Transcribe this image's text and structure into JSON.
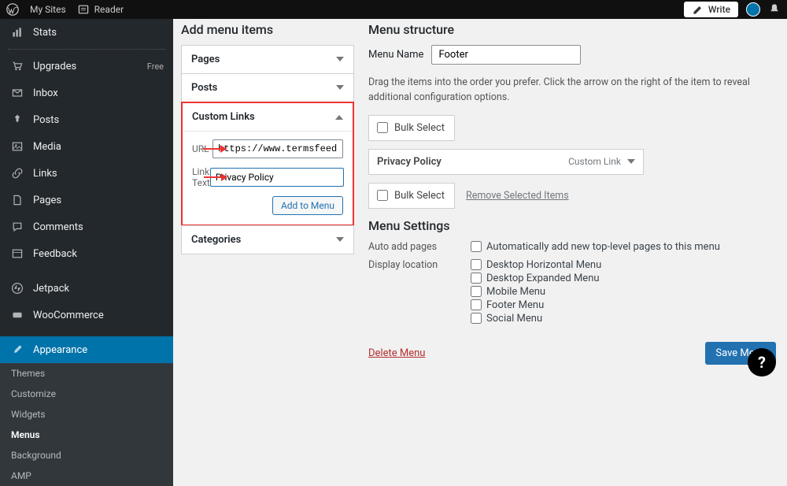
{
  "adminbar": {
    "my_sites": "My Sites",
    "reader": "Reader",
    "write": "Write"
  },
  "sidebar": {
    "items": [
      {
        "icon": "stats",
        "label": "Stats"
      },
      {
        "icon": "cart",
        "label": "Upgrades",
        "badge": "Free"
      },
      {
        "icon": "mail",
        "label": "Inbox"
      },
      {
        "icon": "pin",
        "label": "Posts"
      },
      {
        "icon": "media",
        "label": "Media"
      },
      {
        "icon": "link",
        "label": "Links"
      },
      {
        "icon": "page",
        "label": "Pages"
      },
      {
        "icon": "comment",
        "label": "Comments"
      },
      {
        "icon": "feedback",
        "label": "Feedback"
      },
      {
        "icon": "jetpack",
        "label": "Jetpack"
      },
      {
        "icon": "woo",
        "label": "WooCommerce"
      },
      {
        "icon": "brush",
        "label": "Appearance"
      }
    ],
    "submenu": [
      "Themes",
      "Customize",
      "Widgets",
      "Menus",
      "Background",
      "AMP"
    ]
  },
  "addmenu": {
    "heading": "Add menu items",
    "panels": {
      "pages": "Pages",
      "posts": "Posts",
      "custom": "Custom Links",
      "categories": "Categories"
    },
    "url_label": "URL",
    "url_value": "https://www.termsfeed",
    "linktext_label": "Link Text",
    "linktext_value": "Privacy Policy",
    "add_btn": "Add to Menu"
  },
  "structure": {
    "heading": "Menu structure",
    "name_label": "Menu Name",
    "name_value": "Footer",
    "drag_desc": "Drag the items into the order you prefer. Click the arrow on the right of the item to reveal additional configuration options.",
    "bulk_select": "Bulk Select",
    "menu_item": {
      "label": "Privacy Policy",
      "type": "Custom Link"
    },
    "remove_selected": "Remove Selected Items",
    "settings_heading": "Menu Settings",
    "auto_add_label": "Auto add pages",
    "auto_add_text": "Automatically add new top-level pages to this menu",
    "display_label": "Display location",
    "locations": [
      "Desktop Horizontal Menu",
      "Desktop Expanded Menu",
      "Mobile Menu",
      "Footer Menu",
      "Social Menu"
    ],
    "delete": "Delete Menu",
    "save": "Save Menu"
  }
}
